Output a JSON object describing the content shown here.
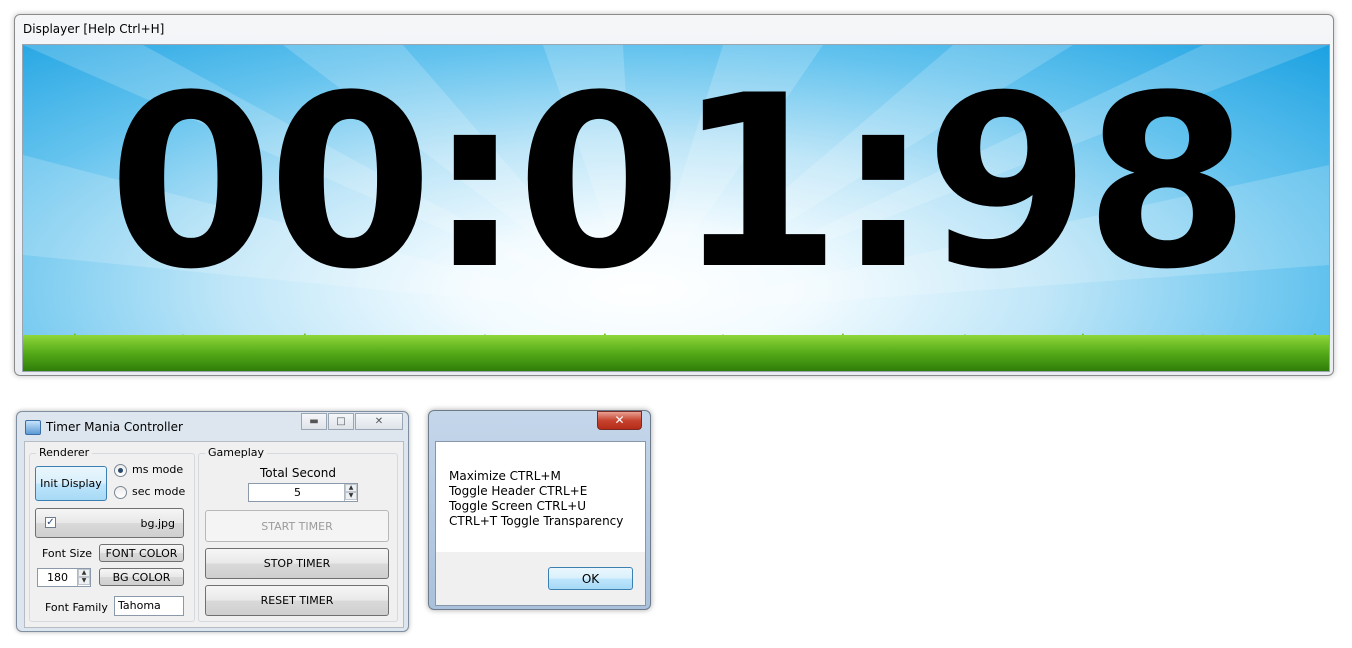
{
  "displayer": {
    "title": "Displayer [Help Ctrl+H]",
    "timer": "00:01:98"
  },
  "controller": {
    "title": "Timer Mania Controller",
    "titlebar_buttons": {
      "minimize": "▬",
      "maximize": "□",
      "close": "✕"
    },
    "renderer": {
      "group_label": "Renderer",
      "init_display_button": "Init Display",
      "ms_mode": {
        "label": "ms mode",
        "selected": true
      },
      "sec_mode": {
        "label": "sec mode",
        "selected": false
      },
      "background": {
        "checked": true,
        "file": "bg.jpg"
      },
      "font_size_label": "Font Size",
      "font_size_value": "180",
      "font_color_button": "FONT COLOR",
      "bg_color_button": "BG COLOR",
      "font_family_label": "Font Family",
      "font_family_value": "Tahoma"
    },
    "gameplay": {
      "group_label": "Gameplay",
      "total_second_label": "Total Second",
      "total_second_value": "5",
      "start_timer_button": "START TIMER",
      "stop_timer_button": "STOP TIMER",
      "reset_timer_button": "RESET TIMER"
    }
  },
  "help_dialog": {
    "close": "✕",
    "lines": [
      "Maximize CTRL+M",
      "Toggle Header CTRL+E",
      "Toggle Screen CTRL+U",
      "CTRL+T Toggle Transparency"
    ],
    "ok_button": "OK"
  }
}
